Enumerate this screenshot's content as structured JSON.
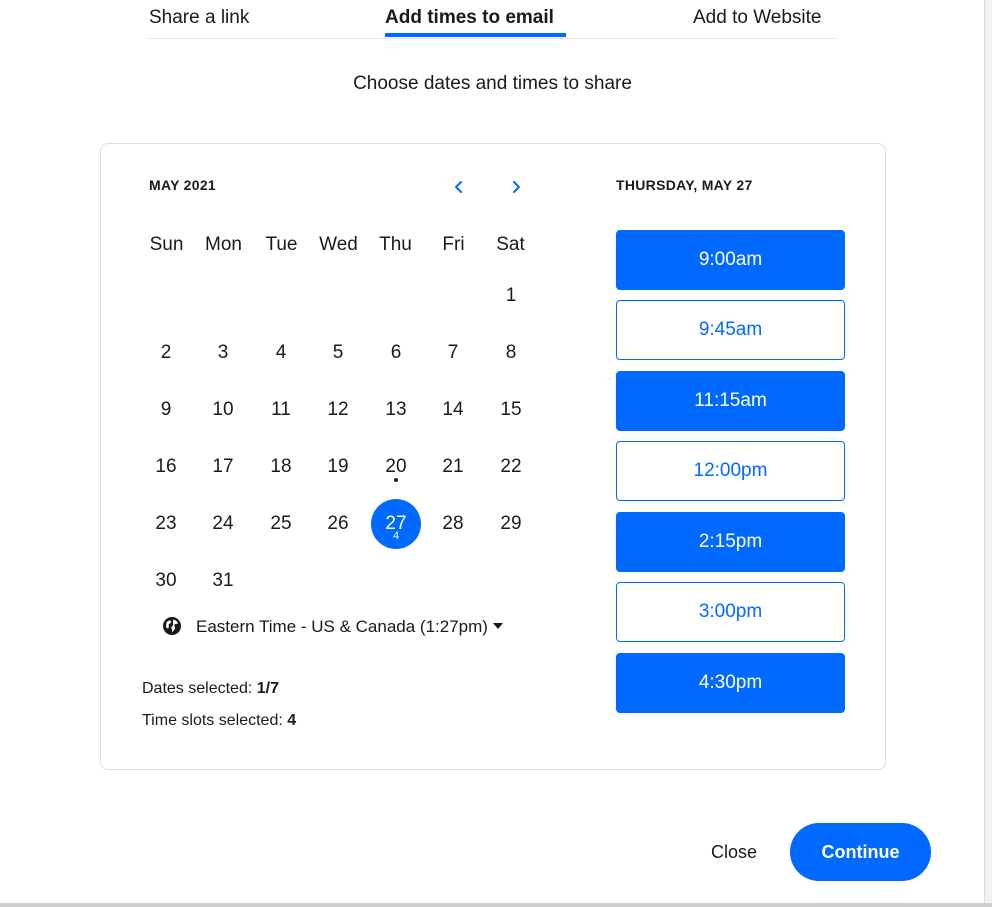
{
  "tabs": [
    {
      "label": "Share a link"
    },
    {
      "label": "Add times to email"
    },
    {
      "label": "Add to Website"
    }
  ],
  "active_tab": "Add times to email",
  "subtitle": "Choose dates and times to share",
  "calendar": {
    "month_label": "MAY 2021",
    "prev_icon": "chevron-left-icon",
    "next_icon": "chevron-right-icon",
    "weekdays": [
      "Sun",
      "Mon",
      "Tue",
      "Wed",
      "Thu",
      "Fri",
      "Sat"
    ],
    "days": [
      "1",
      "2",
      "3",
      "4",
      "5",
      "6",
      "7",
      "8",
      "9",
      "10",
      "11",
      "12",
      "13",
      "14",
      "15",
      "16",
      "17",
      "18",
      "19",
      "20",
      "21",
      "22",
      "23",
      "24",
      "25",
      "26",
      "27",
      "28",
      "29",
      "30",
      "31"
    ],
    "today": "20",
    "selected_day": "27",
    "selected_day_count": "4"
  },
  "timezone": {
    "icon": "globe-icon",
    "label": "Eastern Time - US & Canada (1:27pm)"
  },
  "stats": {
    "dates_label": "Dates selected:",
    "dates_value": "1/7",
    "slots_label": "Time slots selected:",
    "slots_value": "4"
  },
  "day_panel": {
    "heading": "THURSDAY, MAY 27",
    "slots": [
      {
        "time": "9:00am",
        "selected": true
      },
      {
        "time": "9:45am",
        "selected": false
      },
      {
        "time": "11:15am",
        "selected": true
      },
      {
        "time": "12:00pm",
        "selected": false
      },
      {
        "time": "2:15pm",
        "selected": true
      },
      {
        "time": "3:00pm",
        "selected": false
      },
      {
        "time": "4:30pm",
        "selected": true
      }
    ]
  },
  "footer": {
    "close_label": "Close",
    "continue_label": "Continue"
  },
  "colors": {
    "accent": "#0069ff",
    "text": "#1a1a1a",
    "border": "#dcdcdc"
  }
}
